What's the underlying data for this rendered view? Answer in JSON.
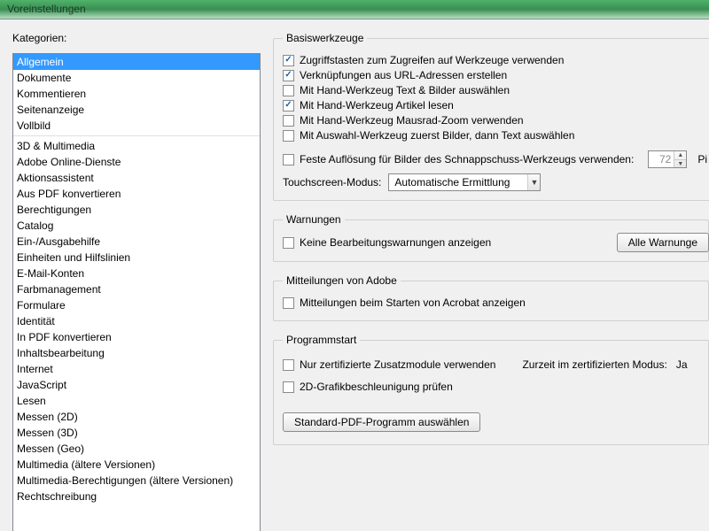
{
  "window": {
    "title": "Voreinstellungen"
  },
  "left": {
    "label": "Kategorien:",
    "group1": [
      "Allgemein",
      "Dokumente",
      "Kommentieren",
      "Seitenanzeige",
      "Vollbild"
    ],
    "group2": [
      "3D & Multimedia",
      "Adobe Online-Dienste",
      "Aktionsassistent",
      "Aus PDF konvertieren",
      "Berechtigungen",
      "Catalog",
      "Ein-/Ausgabehilfe",
      "Einheiten und Hilfslinien",
      "E-Mail-Konten",
      "Farbmanagement",
      "Formulare",
      "Identität",
      "In PDF konvertieren",
      "Inhaltsbearbeitung",
      "Internet",
      "JavaScript",
      "Lesen",
      "Messen (2D)",
      "Messen (3D)",
      "Messen (Geo)",
      "Multimedia (ältere Versionen)",
      "Multimedia-Berechtigungen (ältere Versionen)",
      "Rechtschreibung"
    ],
    "selected": "Allgemein"
  },
  "basis": {
    "legend": "Basiswerkzeuge",
    "opts": [
      {
        "label": "Zugriffstasten zum Zugreifen auf Werkzeuge verwenden",
        "checked": true
      },
      {
        "label": "Verknüpfungen aus URL-Adressen erstellen",
        "checked": true
      },
      {
        "label": "Mit Hand-Werkzeug Text & Bilder auswählen",
        "checked": false
      },
      {
        "label": "Mit Hand-Werkzeug Artikel lesen",
        "checked": true
      },
      {
        "label": "Mit Hand-Werkzeug Mausrad-Zoom verwenden",
        "checked": false
      },
      {
        "label": "Mit Auswahl-Werkzeug zuerst Bilder, dann Text auswählen",
        "checked": false
      }
    ],
    "snapshot": {
      "label": "Feste Auflösung für Bilder des Schnappschuss-Werkzeugs verwenden:",
      "checked": false,
      "value": "72",
      "unit": "Pi"
    },
    "touch": {
      "label": "Touchscreen-Modus:",
      "value": "Automatische Ermittlung"
    }
  },
  "warn": {
    "legend": "Warnungen",
    "opt": {
      "label": "Keine Bearbeitungswarnungen anzeigen",
      "checked": false
    },
    "btn": "Alle Warnunge"
  },
  "adobe": {
    "legend": "Mitteilungen von Adobe",
    "opt": {
      "label": "Mitteilungen beim Starten von Acrobat anzeigen",
      "checked": false
    }
  },
  "prog": {
    "legend": "Programmstart",
    "cert": {
      "label": "Nur zertifizierte Zusatzmodule verwenden",
      "checked": false
    },
    "cert_status_label": "Zurzeit im zertifizierten Modus:",
    "cert_status_value": "Ja",
    "gfx": {
      "label": "2D-Grafikbeschleunigung prüfen",
      "checked": false
    },
    "default_btn": "Standard-PDF-Programm auswählen"
  }
}
